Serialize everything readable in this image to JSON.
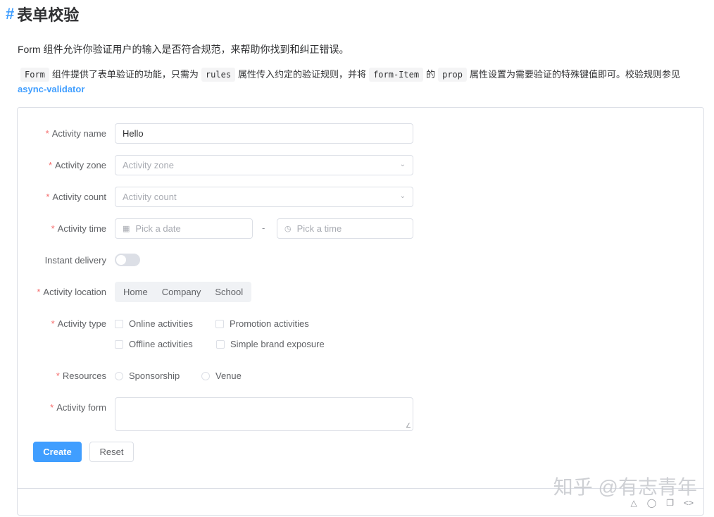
{
  "heading": {
    "hash": "#",
    "title": "表单校验"
  },
  "intro": "Form 组件允许你验证用户的输入是否符合规范，来帮助你找到和纠正错误。",
  "desc": {
    "code1": "Form",
    "text1": "组件提供了表单验证的功能，只需为",
    "code2": "rules",
    "text2": "属性传入约定的验证规则，并将",
    "code3": "form-Item",
    "text3": "的",
    "code4": "prop",
    "text4": "属性设置为需要验证的特殊键值即可。校验规则参见"
  },
  "link": "async-validator",
  "form": {
    "activity_name": {
      "label": "Activity name",
      "value": "Hello"
    },
    "activity_zone": {
      "label": "Activity zone",
      "placeholder": "Activity zone"
    },
    "activity_count": {
      "label": "Activity count",
      "placeholder": "Activity count"
    },
    "activity_time": {
      "label": "Activity time",
      "date_placeholder": "Pick a date",
      "separator": "-",
      "time_placeholder": "Pick a time"
    },
    "instant_delivery": {
      "label": "Instant delivery",
      "on": false
    },
    "activity_location": {
      "label": "Activity location",
      "options": [
        "Home",
        "Company",
        "School"
      ]
    },
    "activity_type": {
      "label": "Activity type",
      "options": [
        "Online activities",
        "Promotion activities",
        "Offline activities",
        "Simple brand exposure"
      ]
    },
    "resources": {
      "label": "Resources",
      "options": [
        "Sponsorship",
        "Venue"
      ]
    },
    "activity_form": {
      "label": "Activity form"
    },
    "required_mark": "*"
  },
  "buttons": {
    "create": "Create",
    "reset": "Reset"
  },
  "watermark": "知乎 @有志青年",
  "icons": [
    "calendar-icon",
    "clock-icon",
    "chevron-down-icon",
    "debug-icon",
    "github-icon",
    "copy-icon",
    "code-icon"
  ],
  "colors": {
    "primary": "#409eff",
    "required": "#f56c6c",
    "border": "#dcdfe6"
  }
}
